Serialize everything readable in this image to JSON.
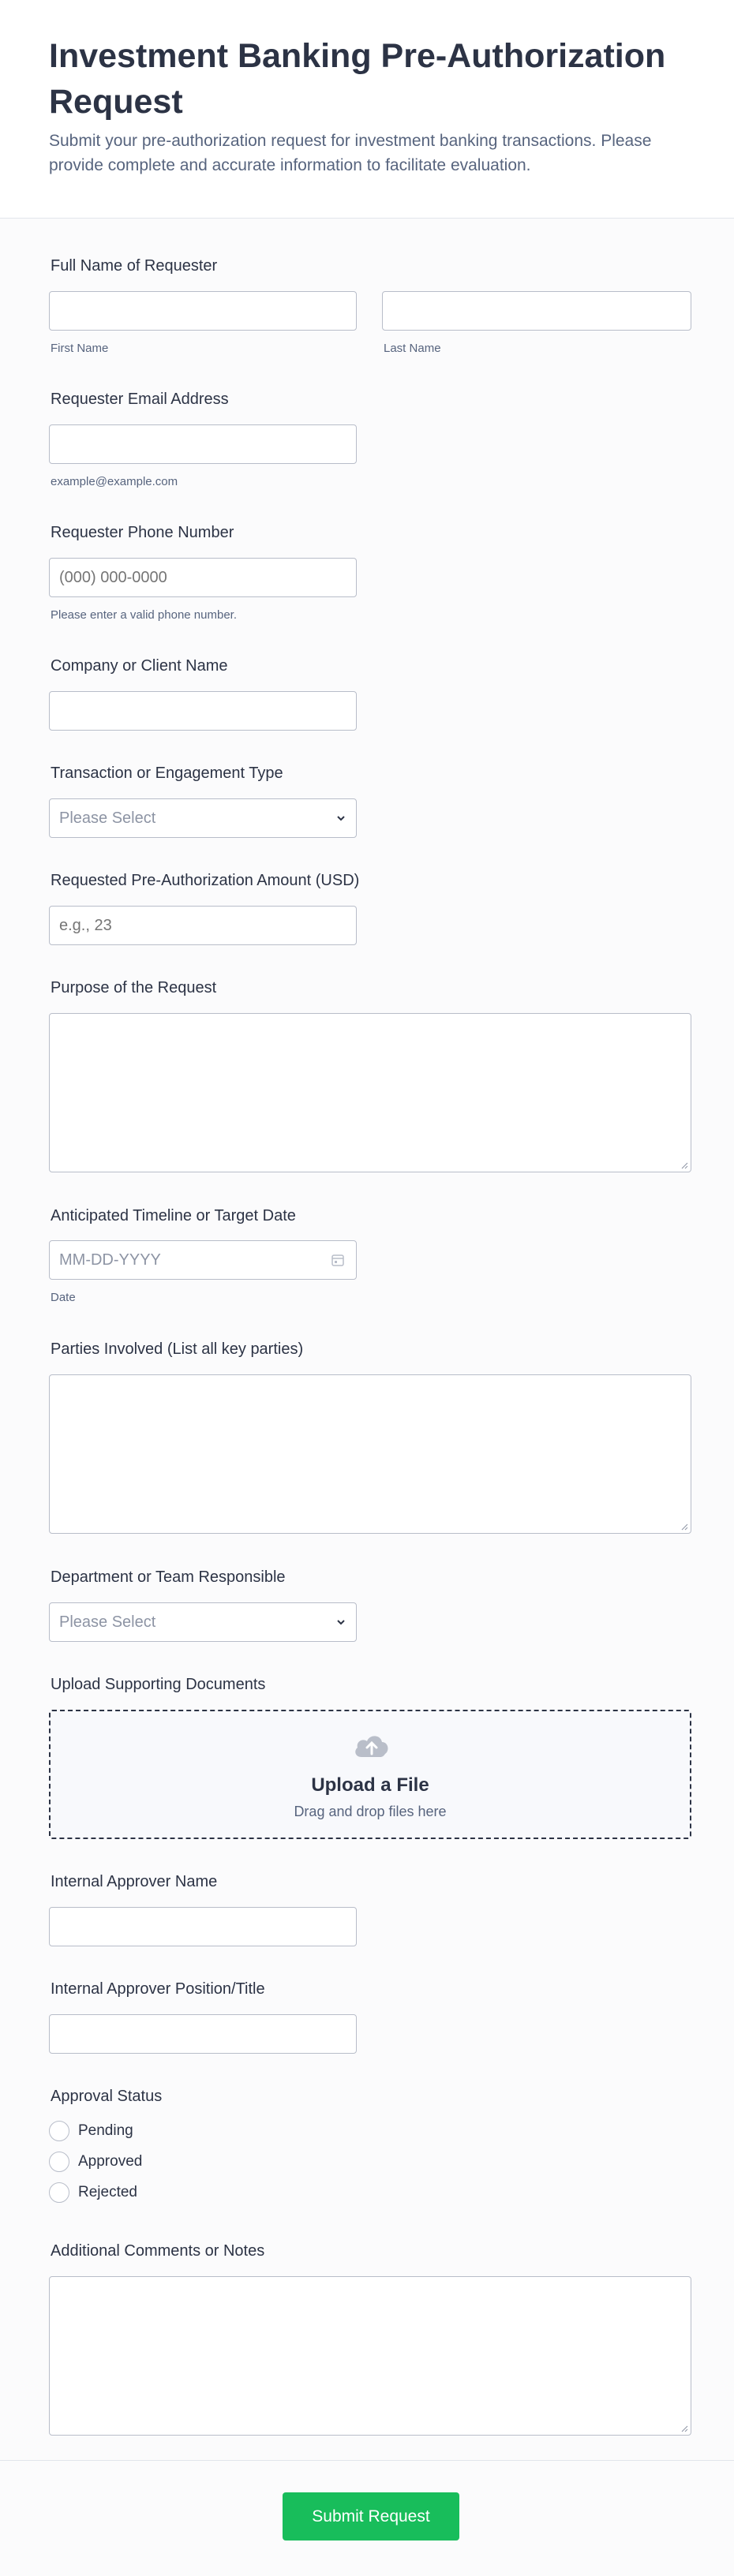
{
  "header": {
    "title": "Investment Banking Pre-Authorization Request",
    "subtitle": "Submit your pre-authorization request for investment banking transactions. Please provide complete and accurate information to facilitate evaluation."
  },
  "fields": {
    "full_name": {
      "label": "Full Name of Requester",
      "first_sublabel": "First Name",
      "last_sublabel": "Last Name"
    },
    "email": {
      "label": "Requester Email Address",
      "sublabel": "example@example.com"
    },
    "phone": {
      "label": "Requester Phone Number",
      "placeholder": "(000) 000-0000",
      "sublabel": "Please enter a valid phone number."
    },
    "company": {
      "label": "Company or Client Name"
    },
    "transaction_type": {
      "label": "Transaction or Engagement Type",
      "placeholder": "Please Select"
    },
    "amount": {
      "label": "Requested Pre-Authorization Amount (USD)",
      "placeholder": "e.g., 23"
    },
    "purpose": {
      "label": "Purpose of the Request"
    },
    "timeline": {
      "label": "Anticipated Timeline or Target Date",
      "placeholder": "MM-DD-YYYY",
      "sublabel": "Date"
    },
    "parties": {
      "label": "Parties Involved (List all key parties)"
    },
    "department": {
      "label": "Department or Team Responsible",
      "placeholder": "Please Select"
    },
    "upload": {
      "label": "Upload Supporting Documents",
      "title": "Upload a File",
      "subtitle": "Drag and drop files here"
    },
    "approver_name": {
      "label": "Internal Approver Name"
    },
    "approver_position": {
      "label": "Internal Approver Position/Title"
    },
    "approval_status": {
      "label": "Approval Status",
      "options": [
        "Pending",
        "Approved",
        "Rejected"
      ]
    },
    "comments": {
      "label": "Additional Comments or Notes"
    }
  },
  "footer": {
    "submit_label": "Submit Request"
  },
  "colors": {
    "accent": "#18bd5b",
    "text": "#2c3345",
    "muted": "#57647e",
    "border": "#b8bdc9"
  }
}
